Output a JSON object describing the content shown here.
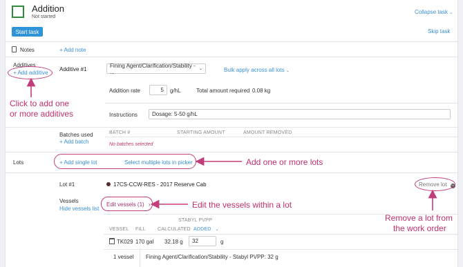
{
  "task": {
    "title": "Addition",
    "status": "Not started",
    "collapse_label": "Collapse task",
    "start_label": "Start task",
    "skip_label": "Skip task"
  },
  "notes": {
    "label": "Notes",
    "add_note": "+ Add note"
  },
  "additives": {
    "label": "Additives",
    "add_additive": "+ Add additive",
    "item_label": "Additive #1",
    "selected_additive": "Fining Agent/Clarification/Stability - ...",
    "bulk_apply": "Bulk apply across all lots",
    "addition_rate_label": "Addition rate",
    "addition_rate_value": "5",
    "addition_rate_unit": "g/hL",
    "total_required_label": "Total amount required",
    "total_required_value": "0.08 kg",
    "instructions_label": "Instructions",
    "instructions_value": "Dosage: 5-50 g/hL"
  },
  "batches": {
    "label": "Batches used",
    "add_batch": "+ Add batch",
    "col_batch": "BATCH #",
    "col_starting": "STARTING AMOUNT",
    "col_removed": "AMOUNT REMOVED",
    "empty_text": "No batches selected"
  },
  "lots": {
    "label": "Lots",
    "add_single": "+ Add single lot",
    "select_multiple": "Select multiple lots in picker",
    "lot_label": "Lot #1",
    "lot_name": "17CS-CCW-RES - 2017 Reserve Cab",
    "remove_lot": "Remove lot",
    "accent_color": "#5a2a32"
  },
  "vessels": {
    "label": "Vessels",
    "hide_list": "Hide vessels list",
    "edit_vessels": "Edit vessels (1)",
    "group_header": "STABYL PVPP",
    "col_vessel": "VESSEL",
    "col_fill": "FILL",
    "col_calculated": "CALCULATED",
    "col_added": "ADDED",
    "row_vessel": "TK029",
    "row_fill": "170 gal",
    "row_calculated": "32.18 g",
    "row_added": "32",
    "row_added_unit": "g",
    "summary_count": "1 vessel",
    "summary_text": "Fining Agent/Clarification/Stability - Stabyl PVPP:  32 g"
  },
  "annotations": {
    "add_additives_line1": "Click to add one",
    "add_additives_line2": "or more additives",
    "add_lots": "Add one or more lots",
    "edit_vessels": "Edit the vessels within a lot",
    "remove_lot_line1": "Remove a lot from",
    "remove_lot_line2": "the work order"
  }
}
